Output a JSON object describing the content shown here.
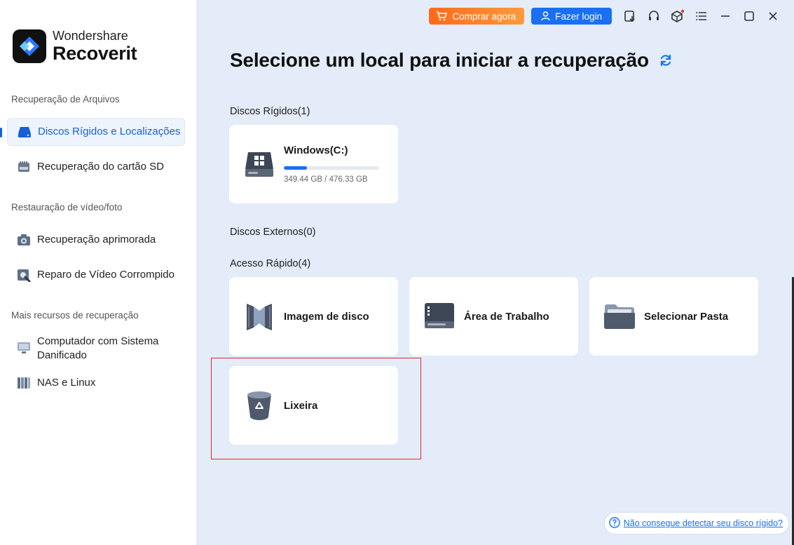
{
  "app": {
    "brand": "Wondershare",
    "product": "Recoverit"
  },
  "sidebar": {
    "sections": [
      {
        "title": "Recuperação de Arquivos",
        "items": [
          {
            "label": "Discos Rígidos e Localizações",
            "icon": "hard-drive-icon",
            "active": true
          },
          {
            "label": "Recuperação do cartão SD",
            "icon": "sd-card-icon",
            "active": false
          }
        ]
      },
      {
        "title": "Restauração de vídeo/foto",
        "items": [
          {
            "label": "Recuperação aprimorada",
            "icon": "camera-icon",
            "active": false
          },
          {
            "label": "Reparo de Vídeo Corrompido",
            "icon": "video-repair-icon",
            "active": false
          }
        ]
      },
      {
        "title": "Mais recursos de recuperação",
        "items": [
          {
            "label": "Computador com Sistema Danificado",
            "icon": "monitor-icon",
            "active": false
          },
          {
            "label": "NAS e Linux",
            "icon": "nas-icon",
            "active": false
          }
        ]
      }
    ]
  },
  "header": {
    "buy_label": "Comprar agora",
    "login_label": "Fazer login",
    "tools": [
      "download-icon",
      "headset-icon",
      "cube-icon",
      "menu-icon",
      "minimize-icon",
      "maximize-icon",
      "close-icon"
    ]
  },
  "main": {
    "title": "Selecione um local para iniciar a recuperação",
    "groups": {
      "hard_disks": {
        "label": "Discos Rígidos(1)",
        "items": [
          {
            "name": "Windows(C:)",
            "size": "349.44 GB / 476.33 GB",
            "used_fraction": 0.2446
          }
        ]
      },
      "external_disks": {
        "label": "Discos Externos(0)"
      },
      "quick_access": {
        "label": "Acesso Rápido(4)",
        "items": [
          {
            "label": "Imagem de disco",
            "icon": "disk-image-icon"
          },
          {
            "label": "Área de Trabalho",
            "icon": "desktop-icon"
          },
          {
            "label": "Selecionar Pasta",
            "icon": "folder-icon"
          },
          {
            "label": "Lixeira",
            "icon": "recycle-bin-icon"
          }
        ]
      }
    },
    "help_link": "Não consegue detectar seu disco rígido?"
  },
  "colors": {
    "accent": "#1a6ff2",
    "buy_gradient_start": "#ff6a1a",
    "main_bg": "#e3ecf8",
    "highlight": "#d62b2b"
  }
}
